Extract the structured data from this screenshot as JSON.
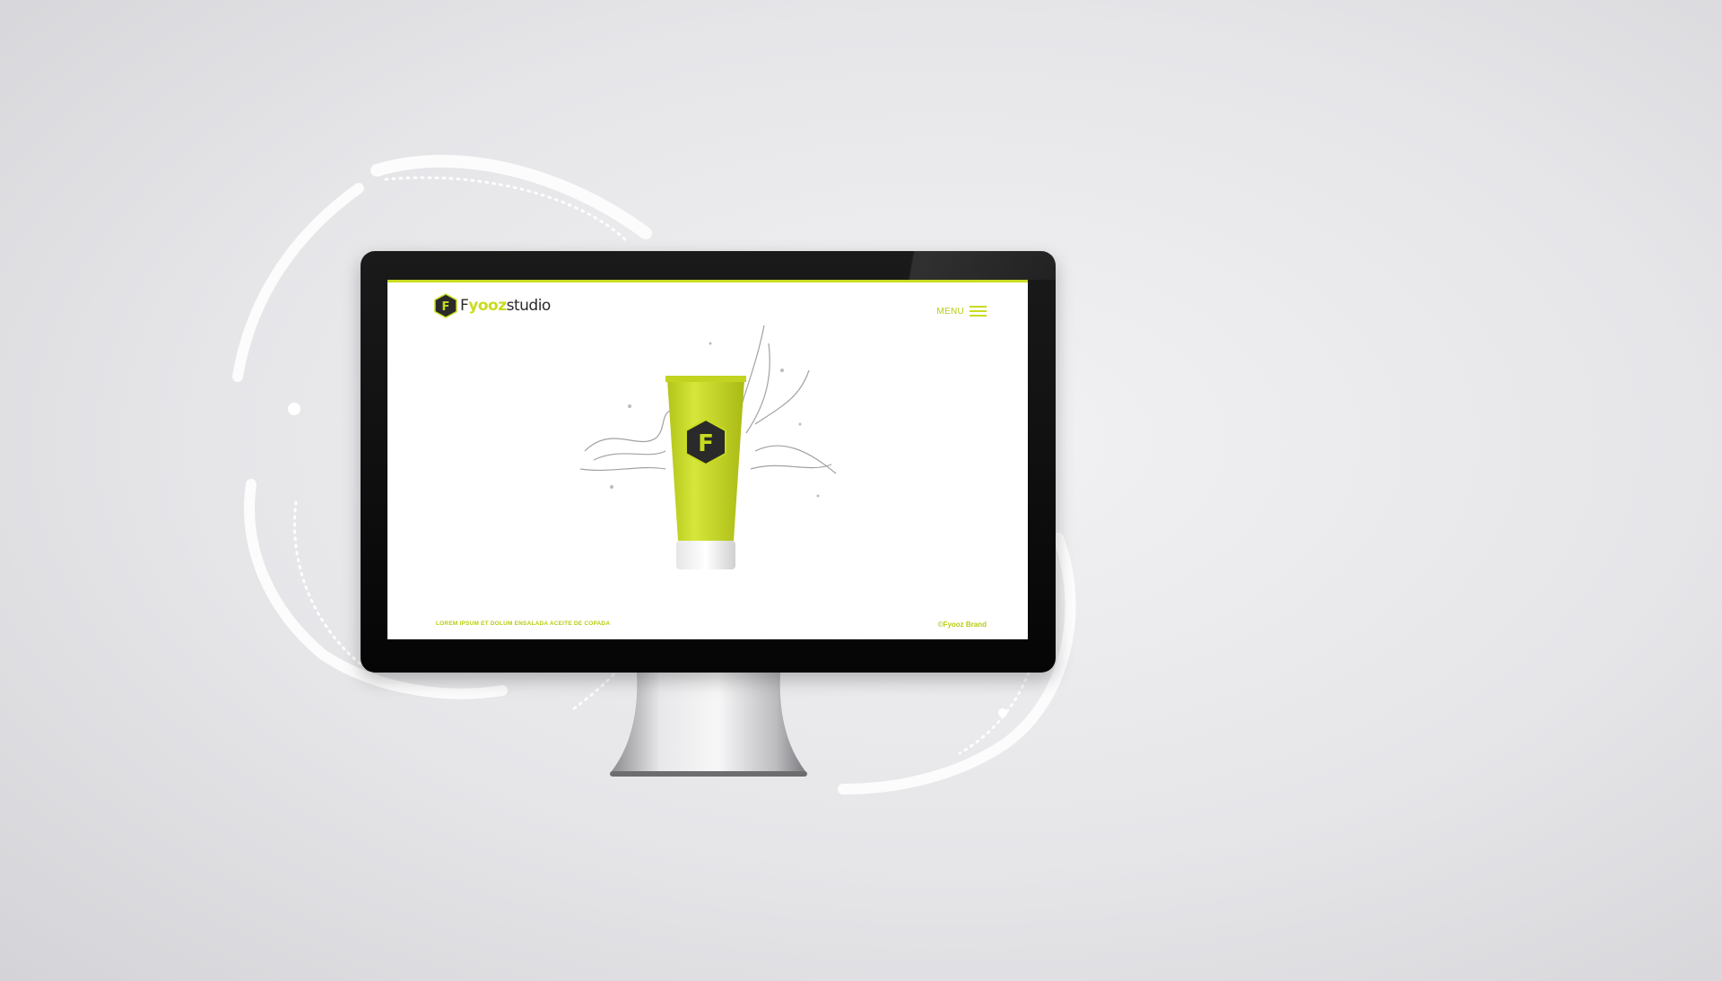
{
  "site": {
    "logo_text_prefix": "F",
    "logo_text_accent": "yooz",
    "logo_text_suffix": "studio",
    "logo_mark_letter": "F",
    "menu_label": "MENU",
    "footer_tagline": "LOREM IPSUM ET DOLUM ENSALADA ACEITE DE COPADA",
    "footer_copyright": "©Fyooz Brand",
    "product_mark_letter": "F"
  },
  "colors": {
    "accent": "#c8dc1e",
    "accent_text": "#b9cc10",
    "dark": "#2a2a2a",
    "bezel": "#0a0a0a"
  },
  "icons": {
    "menu": "hamburger-icon",
    "logo": "hexagon-logo-icon"
  }
}
